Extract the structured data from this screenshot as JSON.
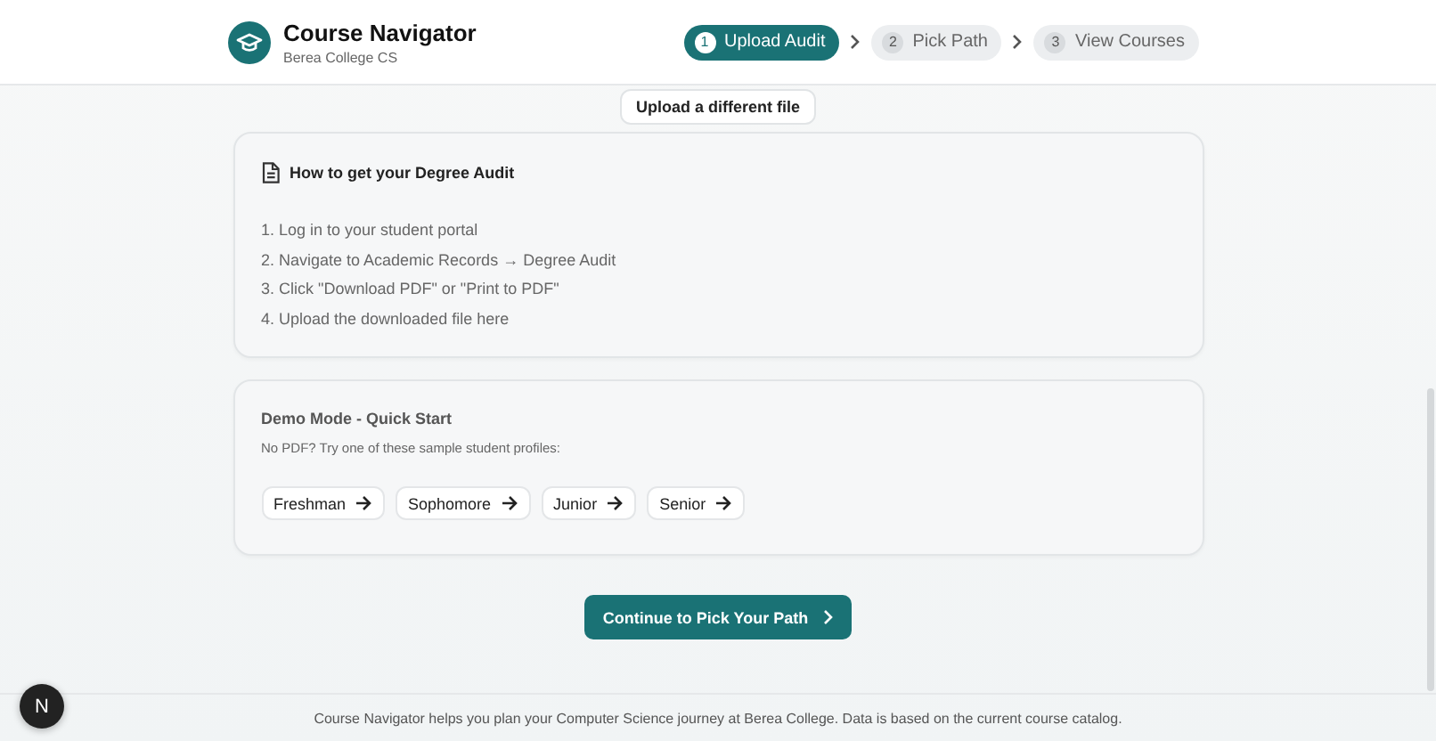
{
  "header": {
    "title": "Course Navigator",
    "subtitle": "Berea College CS",
    "steps": [
      {
        "number": "1",
        "label": "Upload Audit",
        "selected": true
      },
      {
        "number": "2",
        "label": "Pick Path",
        "selected": false
      },
      {
        "number": "3",
        "label": "View Courses",
        "selected": false
      }
    ]
  },
  "upload_button": "Upload a different file",
  "instructions": {
    "title": "How to get your Degree Audit",
    "steps": [
      "1. Log in to your student portal",
      "2. Navigate to Academic Records → Degree Audit",
      "3. Click \"Download PDF\" or \"Print to PDF\"",
      "4. Upload the downloaded file here"
    ]
  },
  "demo": {
    "title": "Demo Mode - Quick Start",
    "description": "No PDF? Try one of these sample student profiles:",
    "profiles": [
      "Freshman",
      "Sophomore",
      "Junior",
      "Senior"
    ]
  },
  "continue_button": "Continue to Pick Your Path",
  "footer": "Course Navigator helps you plan your Computer Science journey at Berea College. Data is based on the current course catalog.",
  "dev_badge": "N"
}
